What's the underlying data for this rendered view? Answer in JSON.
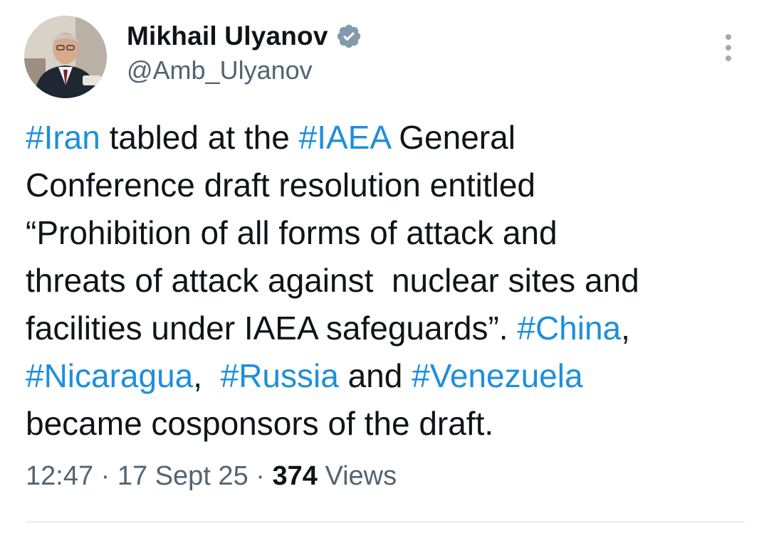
{
  "author": {
    "name": "Mikhail Ulyanov",
    "handle": "@Amb_Ulyanov",
    "verified_icon": "verified-badge-icon"
  },
  "menu": {
    "icon": "more-options-icon"
  },
  "tweet": {
    "segments": [
      {
        "text": "#Iran",
        "hashtag": true
      },
      {
        "text": " tabled at the ",
        "hashtag": false
      },
      {
        "text": "#IAEA",
        "hashtag": true
      },
      {
        "text": " General\nConference draft resolution entitled\n“Prohibition of all forms of attack and\nthreats of attack against  nuclear sites and\nfacilities under IAEA safeguards”. ",
        "hashtag": false
      },
      {
        "text": "#China",
        "hashtag": true
      },
      {
        "text": ",\n",
        "hashtag": false
      },
      {
        "text": "#Nicaragua",
        "hashtag": true
      },
      {
        "text": ",  ",
        "hashtag": false
      },
      {
        "text": "#Russia",
        "hashtag": true
      },
      {
        "text": " and ",
        "hashtag": false
      },
      {
        "text": "#Venezuela",
        "hashtag": true
      },
      {
        "text": "\nbecame cosponsors of the draft.",
        "hashtag": false
      }
    ]
  },
  "meta": {
    "time": "12:47",
    "sep1": " · ",
    "date": "17 Sept 25",
    "sep2": " · ",
    "views_count": "374",
    "views_label": " Views"
  },
  "colors": {
    "hashtag": "#1d8fdc",
    "verified_badge": "#829aab",
    "text": "#0f1419",
    "secondary": "#536471"
  }
}
